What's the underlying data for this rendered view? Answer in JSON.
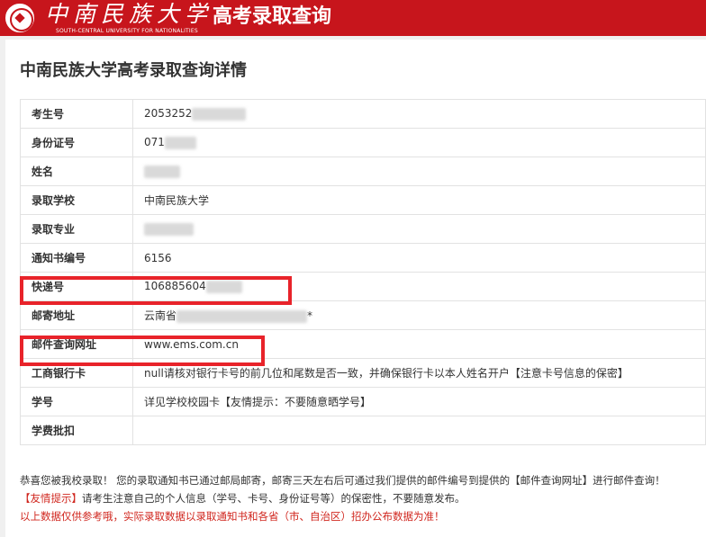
{
  "header": {
    "university_cn": "中南民族大学",
    "university_en": "SOUTH-CENTRAL UNIVERSITY FOR NATIONALITIES",
    "title": "高考录取查询"
  },
  "page": {
    "title": "中南民族大学高考录取查询详情"
  },
  "rows": [
    {
      "label": "考生号",
      "value": "2053252"
    },
    {
      "label": "身份证号",
      "value": "071"
    },
    {
      "label": "姓名",
      "value": ""
    },
    {
      "label": "录取学校",
      "value": "中南民族大学"
    },
    {
      "label": "录取专业",
      "value": ""
    },
    {
      "label": "通知书编号",
      "value": "6156"
    },
    {
      "label": "快递号",
      "value": "106885604"
    },
    {
      "label": "邮寄地址",
      "value": "云南省",
      "suffix": "*"
    },
    {
      "label": "邮件查询网址",
      "value": "www.ems.com.cn"
    },
    {
      "label": "工商银行卡",
      "value": "null请核对银行卡号的前几位和尾数是否一致，并确保银行卡以本人姓名开户【注意卡号信息的保密】"
    },
    {
      "label": "学号",
      "value": "详见学校校园卡【友情提示：不要随意晒学号】"
    },
    {
      "label": "学费批扣",
      "value": ""
    }
  ],
  "notes": {
    "line1": "恭喜您被我校录取！ 您的录取通知书已通过邮局邮寄，邮寄三天左右后可通过我们提供的邮件编号到提供的【邮件查询网址】进行邮件查询！",
    "line2_tag": "【友情提示】",
    "line2_text": "请考生注意自己的个人信息（学号、卡号、身份证号等）的保密性，不要随意发布。",
    "line3": "以上数据仅供参考哦，实际录取数据以录取通知书和各省（市、自治区）招办公布数据为准！"
  },
  "colors": {
    "brand_red": "#c7151c",
    "highlight": "#e8232a",
    "note_red": "#d0261e"
  }
}
